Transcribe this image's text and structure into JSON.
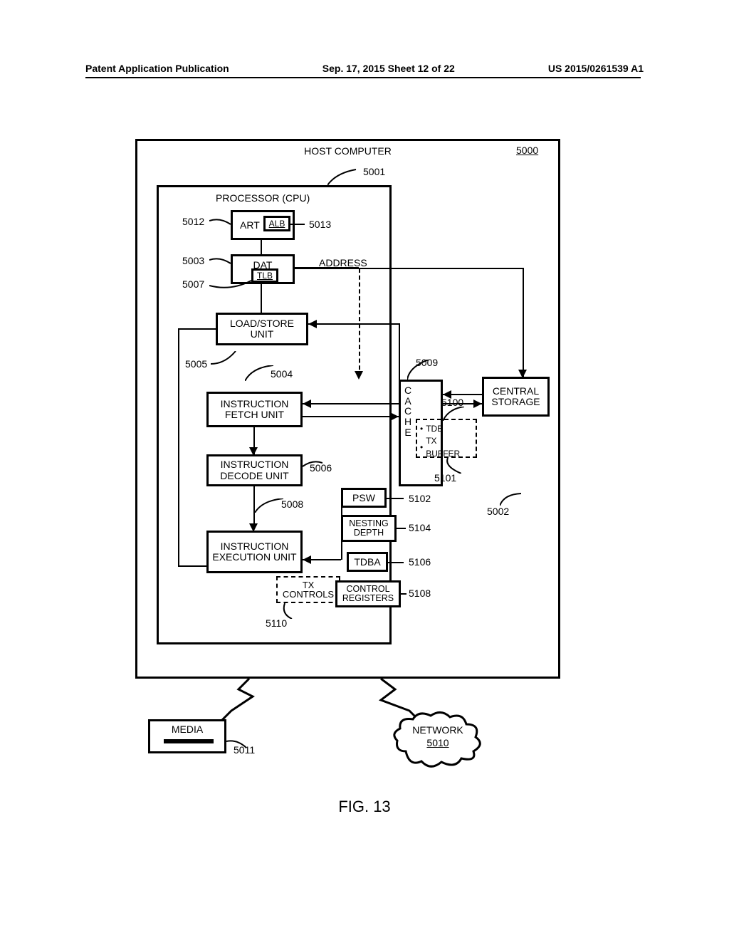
{
  "header": {
    "left": "Patent Application Publication",
    "center": "Sep. 17, 2015  Sheet 12 of 22",
    "right": "US 2015/0261539 A1"
  },
  "diagram": {
    "host_computer": "HOST COMPUTER",
    "ref_5000": "5000",
    "processor": "PROCESSOR (CPU)",
    "ref_5001": "5001",
    "art": "ART",
    "alb": "ALB",
    "ref_5012": "5012",
    "ref_5013": "5013",
    "dat": "DAT",
    "ref_5003": "5003",
    "tlb": "TLB",
    "ref_5007": "5007",
    "address": "ADDRESS",
    "load_store": "LOAD/STORE UNIT",
    "ref_5005": "5005",
    "fetch": "INSTRUCTION FETCH UNIT",
    "ref_5004": "5004",
    "decode": "INSTRUCTION DECODE UNIT",
    "ref_5006": "5006",
    "exec": "INSTRUCTION EXECUTION UNIT",
    "ref_5008": "5008",
    "tx_controls": "TX CONTROLS",
    "ref_5110": "5110",
    "cache": "CACHE",
    "ref_5009": "5009",
    "tdb": "TDB",
    "tx_buffer": "TX BUFFER",
    "ref_5100": "5100",
    "ref_5101": "5101",
    "psw": "PSW",
    "ref_5102": "5102",
    "nesting": "NESTING DEPTH",
    "ref_5104": "5104",
    "tdba": "TDBA",
    "ref_5106": "5106",
    "control_regs": "CONTROL REGISTERS",
    "ref_5108": "5108",
    "central_storage": "CENTRAL STORAGE",
    "ref_5002": "5002",
    "media": "MEDIA",
    "ref_5011": "5011",
    "network": "NETWORK",
    "ref_5010": "5010",
    "bullet": "•"
  },
  "caption": "FIG. 13"
}
